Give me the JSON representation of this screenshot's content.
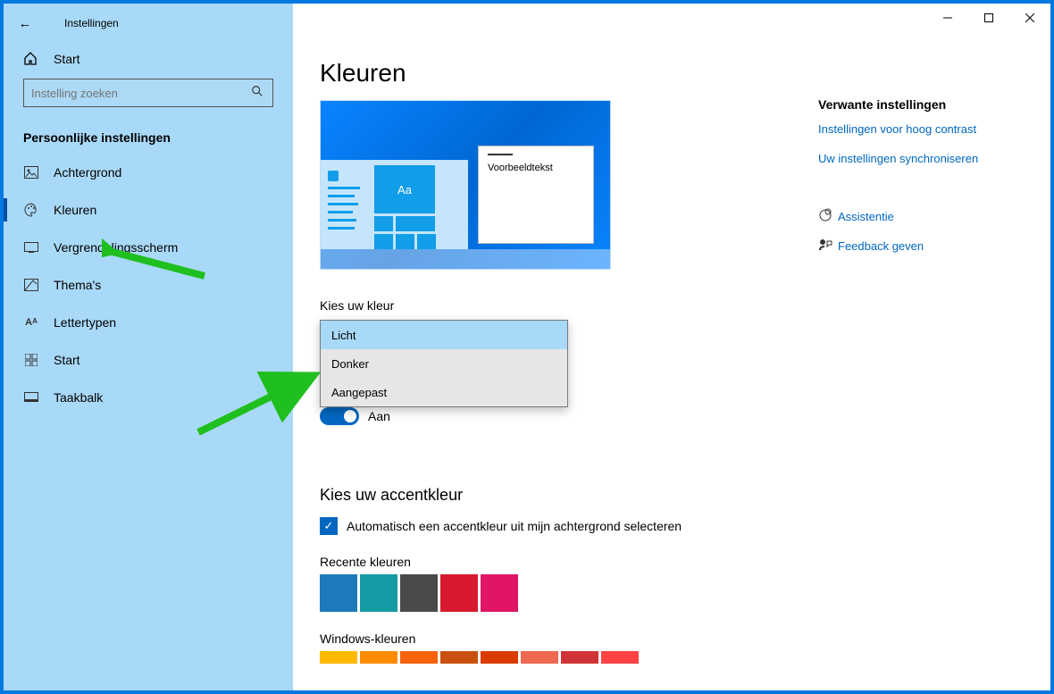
{
  "app_title": "Instellingen",
  "home_label": "Start",
  "search_placeholder": "Instelling zoeken",
  "section_title": "Persoonlijke instellingen",
  "sidebar": {
    "items": [
      {
        "label": "Achtergrond"
      },
      {
        "label": "Kleuren"
      },
      {
        "label": "Vergrendelingsscherm"
      },
      {
        "label": "Thema's"
      },
      {
        "label": "Lettertypen"
      },
      {
        "label": "Start"
      },
      {
        "label": "Taakbalk"
      }
    ]
  },
  "page_title": "Kleuren",
  "preview_text": "Voorbeeldtekst",
  "preview_tile": "Aa",
  "choose_color_label": "Kies uw kleur",
  "color_options": [
    "Licht",
    "Donker",
    "Aangepast"
  ],
  "toggle_label": "Aan",
  "accent_title": "Kies uw accentkleur",
  "auto_accent_label": "Automatisch een accentkleur uit mijn achtergrond selecteren",
  "recent_label": "Recente kleuren",
  "recent_colors": [
    "#1e7aba",
    "#159ba4",
    "#4a4a4a",
    "#d71a2f",
    "#e01566"
  ],
  "windows_colors_label": "Windows-kleuren",
  "windows_colors": [
    "#ffb900",
    "#ff8c00",
    "#f7630c",
    "#ca5010",
    "#da3b01",
    "#ef6950",
    "#d13438",
    "#ff4343"
  ],
  "right": {
    "title": "Verwante instellingen",
    "links": [
      "Instellingen voor hoog contrast",
      "Uw instellingen synchroniseren"
    ],
    "help": [
      {
        "icon": "assist",
        "label": "Assistentie"
      },
      {
        "icon": "feedback",
        "label": "Feedback geven"
      }
    ]
  }
}
